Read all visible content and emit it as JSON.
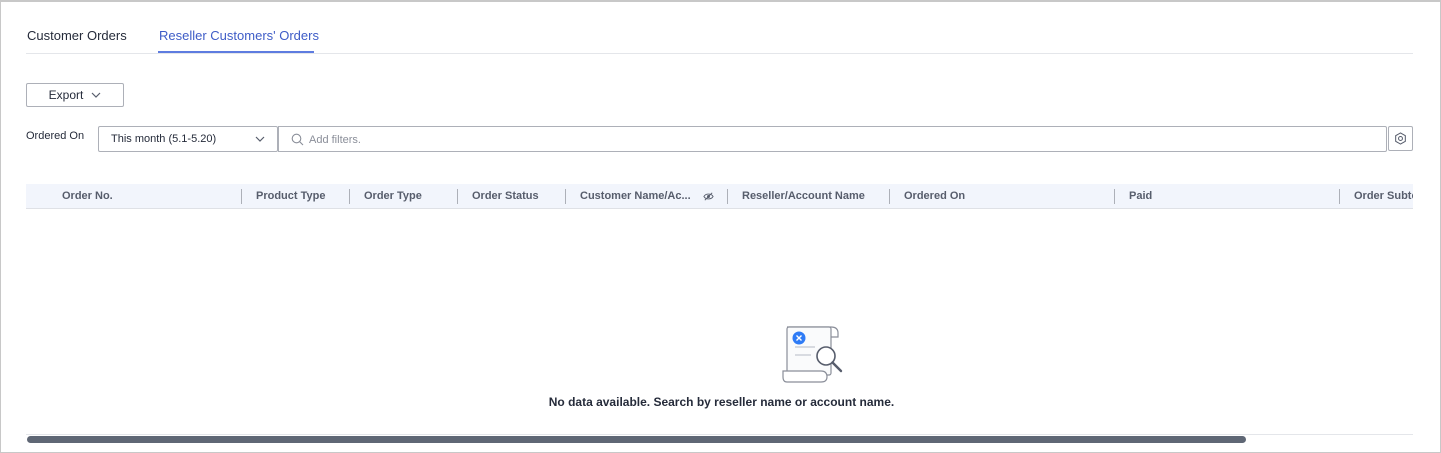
{
  "tabs": [
    {
      "label": "Customer Orders",
      "active": false
    },
    {
      "label": "Reseller Customers' Orders",
      "active": true
    }
  ],
  "toolbar": {
    "export_label": "Export",
    "export_icon": "chevron-down-icon"
  },
  "filters": {
    "ordered_on_label": "Ordered On",
    "date_range_value": "This month (5.1-5.20)",
    "search_placeholder": "Add filters.",
    "search_icon": "search-icon",
    "settings_icon": "gear-icon"
  },
  "table": {
    "columns": [
      "Order No.",
      "Product Type",
      "Order Type",
      "Order Status",
      "Customer Name/Ac...",
      "Reseller/Account Name",
      "Ordered On",
      "Paid",
      "Order Subto"
    ],
    "column_icon": "eye-icon"
  },
  "empty_state": {
    "icon": "no-data-icon",
    "message": "No data available. Search by reseller name or account name."
  },
  "colors": {
    "active_tab": "#3e5cc7",
    "tab_underline": "#5e7ce0",
    "header_bg": "#f2f5fc",
    "scrollbar": "#5f6775",
    "empty_badge": "#2f7cf6"
  }
}
